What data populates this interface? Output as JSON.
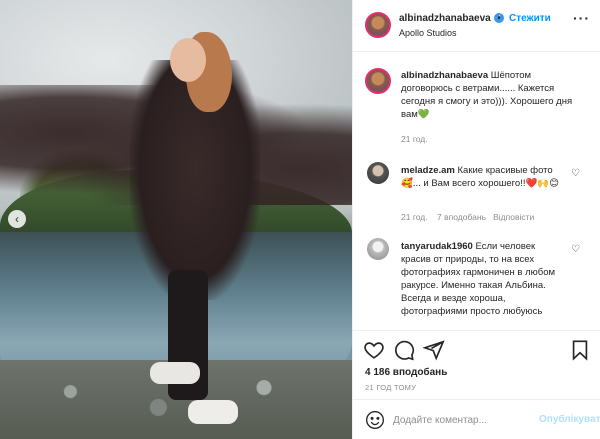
{
  "post": {
    "author": "albinadzhanabaeva",
    "follow_label": "Стежити",
    "separator": "•",
    "location": "Apollo Studios",
    "more_label": "···"
  },
  "caption": {
    "author": "albinadzhanabaeva",
    "text": "Шёпотом договорюсь с ветрами...... Кажется сегодня я смогу и это))). Хорошего дня вам💚",
    "time": "21 год."
  },
  "comments": [
    {
      "author": "meladze.am",
      "text": "Какие красивые фото🥰... и Вам всего хорошего!!❤️🙌😊",
      "time": "21 год.",
      "likes": "7 вподобань",
      "reply": "Відповісти"
    },
    {
      "author": "tanyarudak1960",
      "text": "Если человек красив от природы, то на всех фотографиях гармоничен в любом ракурсе. Именно такая Альбина. Всегда и везде хороша, фотографиями просто любуюсь"
    }
  ],
  "stats": {
    "likes": "4 186 вподобань",
    "time_ago": "21 ГОД ТОМУ"
  },
  "comment_box": {
    "placeholder": "Додайте коментар...",
    "post_label": "Опублікувати"
  },
  "icons": {
    "prev": "chevron-left-icon",
    "like": "heart-icon",
    "comment": "comment-icon",
    "share": "paper-plane-icon",
    "save": "bookmark-icon",
    "emoji": "smiley-icon",
    "verified": "verified-badge-icon"
  },
  "colors": {
    "link_blue": "#0095f6",
    "verified_blue": "#3897f0",
    "muted": "#8e8e8e",
    "post_disabled": "#b2dffc"
  }
}
